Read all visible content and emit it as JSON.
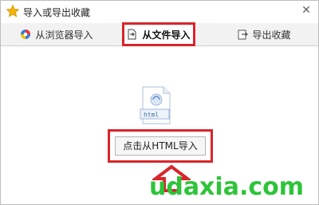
{
  "window": {
    "title": "导入或导出收藏",
    "close_label": "✕"
  },
  "tabs": [
    {
      "label": "从浏览器导入",
      "icon": "browser-import-icon",
      "active": false
    },
    {
      "label": "从文件导入",
      "icon": "file-import-icon",
      "active": true
    },
    {
      "label": "导出收藏",
      "icon": "export-icon",
      "active": false
    }
  ],
  "file_icon": {
    "label": "html",
    "icon": "html-file-icon"
  },
  "import_button": {
    "label": "点击从HTML导入"
  },
  "watermark": {
    "text": "udaxia.com"
  },
  "colors": {
    "highlight": "#d9252b",
    "watermark": "#2ec43a",
    "star": "#f4b400"
  }
}
